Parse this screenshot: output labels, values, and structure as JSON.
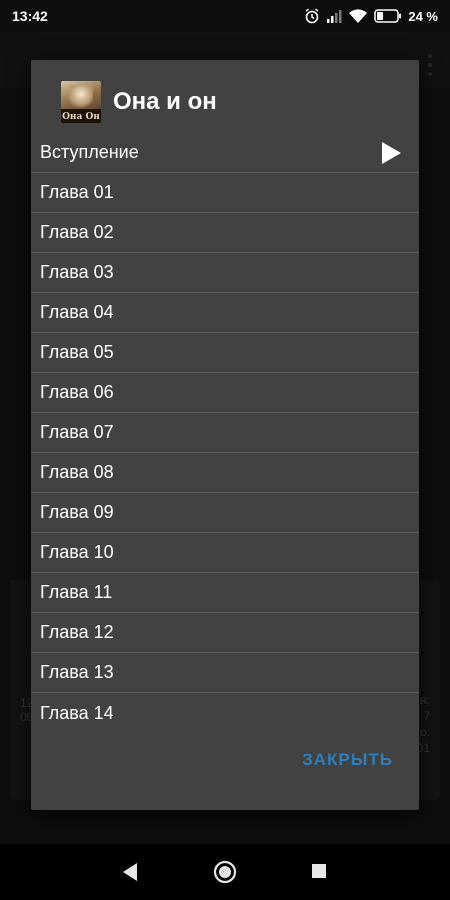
{
  "status_bar": {
    "time": "13:42",
    "battery": "24 %",
    "icons": [
      "alarm-icon",
      "signal-icon",
      "wifi-icon",
      "battery-icon"
    ]
  },
  "background": {
    "left_text": [
      "12",
      "06"
    ],
    "right_text": [
      "я:",
      "7",
      "о:",
      "01"
    ]
  },
  "dialog": {
    "title": "Она и он",
    "cover_text": "Она Он",
    "chapters": [
      {
        "label": "Вступление",
        "playing": true
      },
      {
        "label": "Глава 01"
      },
      {
        "label": "Глава 02"
      },
      {
        "label": "Глава 03"
      },
      {
        "label": "Глава 04"
      },
      {
        "label": "Глава 05"
      },
      {
        "label": "Глава 06"
      },
      {
        "label": "Глава 07"
      },
      {
        "label": "Глава 08"
      },
      {
        "label": "Глава 09"
      },
      {
        "label": "Глава 10"
      },
      {
        "label": "Глава 11"
      },
      {
        "label": "Глава 12"
      },
      {
        "label": "Глава 13"
      },
      {
        "label": "Глава 14"
      }
    ],
    "close_label": "ЗАКРЫТЬ"
  },
  "colors": {
    "dialog_bg": "#424242",
    "accent": "#2e7fbd",
    "divider": "#5e5e5e"
  },
  "nav": {
    "icons": [
      "back-icon",
      "home-icon",
      "recents-icon"
    ]
  }
}
